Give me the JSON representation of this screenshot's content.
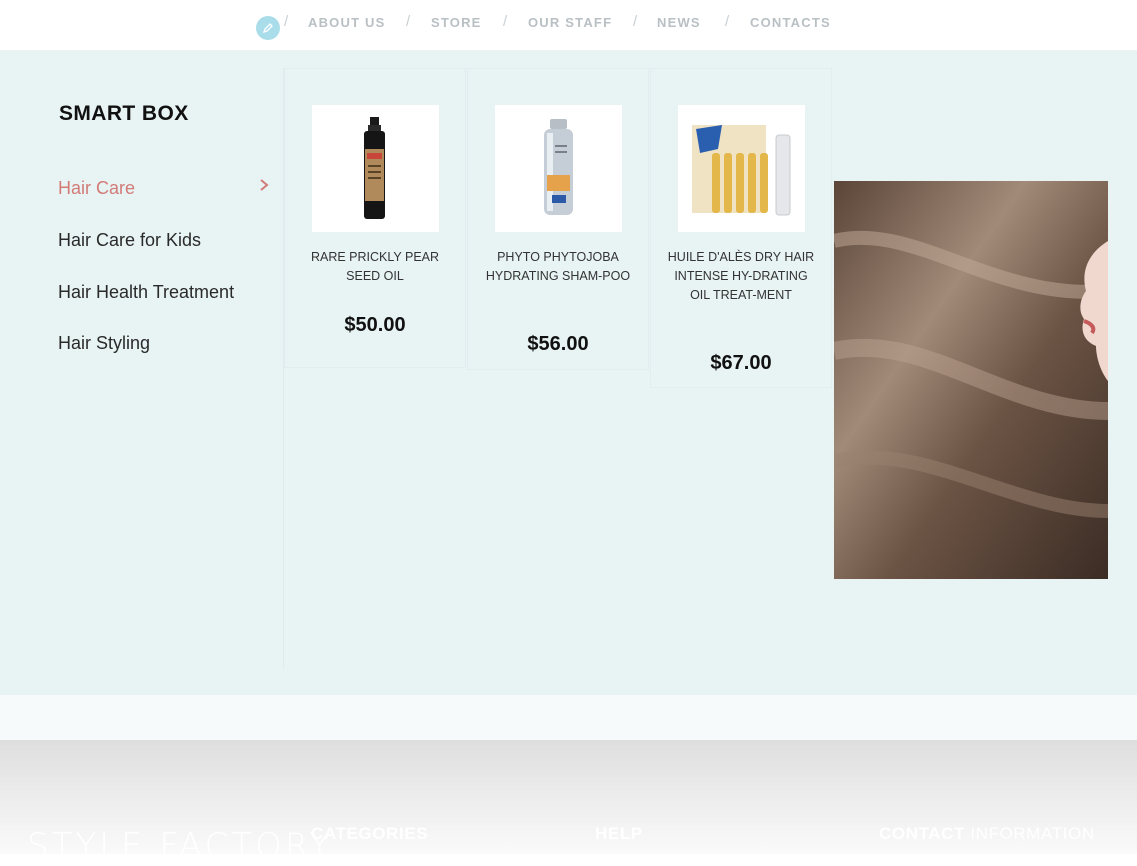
{
  "nav": {
    "items": [
      "ABOUT US",
      "STORE",
      "OUR STAFF",
      "NEWS",
      "CONTACTS"
    ],
    "separator": "/"
  },
  "mega_menu": {
    "title": "SMART BOX",
    "categories": [
      "Hair Care",
      "Hair Care for Kids",
      "Hair Health Treatment",
      "Hair Styling"
    ],
    "active_category": "Hair Care",
    "products": [
      {
        "name": "RARE PRICKLY PEAR SEED OIL",
        "price": "$50.00"
      },
      {
        "name": "PHYTO PHYTOJOBA HYDRATING SHAM-POO",
        "price": "$56.00"
      },
      {
        "name": "HUILE D'ALÈS DRY HAIR INTENSE HY-DRATING OIL TREAT-MENT",
        "price": "$67.00"
      }
    ]
  },
  "footer": {
    "logo": "STYLE FACTORY",
    "headings": {
      "categories": "CATEGORIES",
      "help": "HELP",
      "contact_bold": "CONTACT",
      "contact_light": "INFORMATION"
    }
  },
  "colors": {
    "accent": "#d27b77",
    "menu_bg": "#e8f3f4",
    "nav_text": "#b9c0c4"
  }
}
